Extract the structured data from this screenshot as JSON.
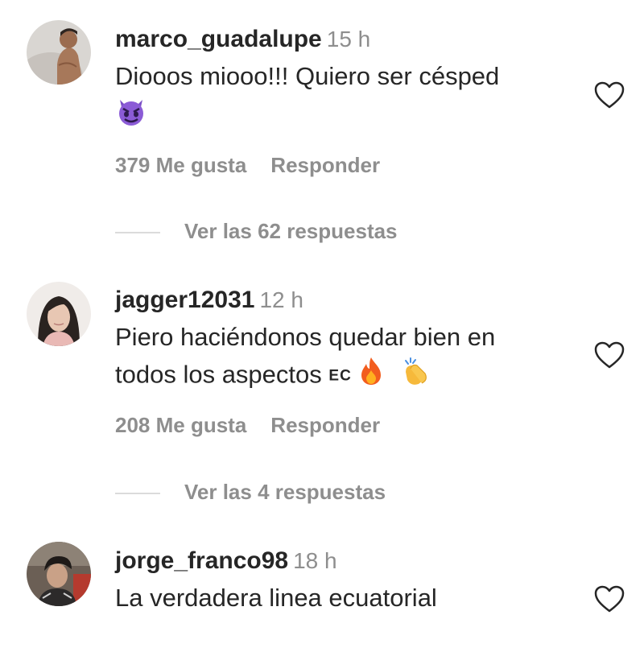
{
  "comments": [
    {
      "username": "marco_guadalupe",
      "time": "15 h",
      "text": "Diooos miooo!!! Quiero ser césped",
      "emojis": [
        "smiling-face-with-horns-emoji"
      ],
      "likes": "379 Me gusta",
      "reply": "Responder",
      "view_replies": "Ver las 62 respuestas",
      "avatar": "avatar-shirtless-man"
    },
    {
      "username": "jagger12031",
      "time": "12 h",
      "text_line1": "Piero haciéndonos quedar bien en",
      "text_line2": "todos los aspectos",
      "flag_text": "EC",
      "emojis": [
        "fire-emoji",
        "clapping-hands-emoji"
      ],
      "likes": "208 Me gusta",
      "reply": "Responder",
      "view_replies": "Ver las 4 respuestas",
      "avatar": "avatar-young-woman"
    },
    {
      "username": "jorge_franco98",
      "time": "18 h",
      "text": "La verdadera linea ecuatorial",
      "avatar": "avatar-man-with-cap"
    }
  ],
  "colors": {
    "text": "#262626",
    "secondary": "#8e8e8e",
    "divider": "#dbdbdb"
  },
  "icons": [
    "heart-outline-icon"
  ]
}
